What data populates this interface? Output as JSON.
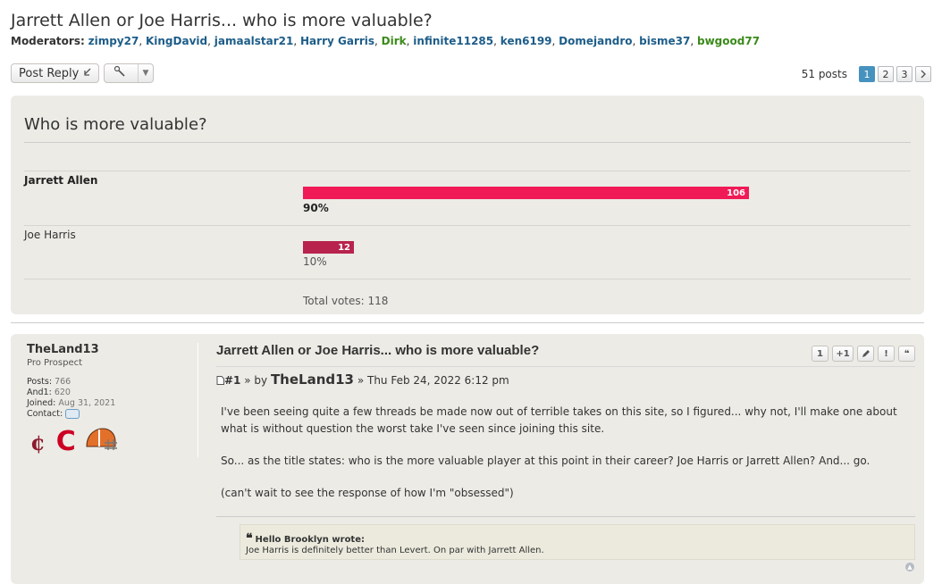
{
  "topic": {
    "title": "Jarrett Allen or Joe Harris... who is more valuable?",
    "moderators_label": "Moderators:",
    "moderators": [
      {
        "name": "zimpy27",
        "color": "#1d5d89"
      },
      {
        "name": "KingDavid",
        "color": "#1d5d89"
      },
      {
        "name": "jamaalstar21",
        "color": "#1d5d89"
      },
      {
        "name": "Harry Garris",
        "color": "#1d5d89"
      },
      {
        "name": "Dirk",
        "color": "#3b8a1b"
      },
      {
        "name": "infinite11285",
        "color": "#1d5d89"
      },
      {
        "name": "ken6199",
        "color": "#1d5d89"
      },
      {
        "name": "Domejandro",
        "color": "#1d5d89"
      },
      {
        "name": "bisme37",
        "color": "#1d5d89"
      },
      {
        "name": "bwgood77",
        "color": "#3b8a1b"
      }
    ]
  },
  "toolbar": {
    "post_reply_label": "Post Reply",
    "post_reply_icon": "reply-arrow-icon",
    "tools_icon": "wrench-icon"
  },
  "pagination": {
    "posts_count": "51 posts",
    "pages": [
      "1",
      "2",
      "3"
    ],
    "current_page": "1",
    "next_icon": "chevron-right-icon"
  },
  "poll": {
    "question": "Who is more valuable?",
    "options": [
      {
        "label": "Jarrett Allen",
        "votes": "106",
        "percent": "90%",
        "fraction": 0.898,
        "color": "#f01a56"
      },
      {
        "label": "Joe Harris",
        "votes": "12",
        "percent": "10%",
        "fraction": 0.102,
        "color": "#b8234d"
      }
    ],
    "total_votes": "Total votes: 118"
  },
  "post": {
    "author": {
      "username": "TheLand13",
      "rank": "Pro Prospect",
      "posts_label": "Posts:",
      "posts_value": "766",
      "and1_label": "And1:",
      "and1_value": "620",
      "joined_label": "Joined:",
      "joined_value": "Aug 31, 2021",
      "contact_label": "Contact:",
      "logos": [
        "cavaliers-logo",
        "guardians-logo",
        "browns-logo"
      ]
    },
    "title": "Jarrett Allen or Joe Harris... who is more valuable?",
    "action_buttons": [
      "1",
      "+1",
      "edit-icon",
      "!",
      "quote-icon"
    ],
    "meta": {
      "number": "#1",
      "by": "» by",
      "author": "TheLand13",
      "date": "» Thu Feb 24, 2022 6:12 pm"
    },
    "paragraphs": [
      "I've been seeing quite a few threads be made now out of terrible takes on this site, so I figured... why not, I'll make one about what is without question the worst take I've seen since joining this site.",
      "So... as the title states: who is the more valuable player at this point in their career? Joe Harris or Jarrett Allen? And... go.",
      "(can't wait to see the response of how I'm \"obsessed\")"
    ],
    "quote": {
      "author_line": "Hello Brooklyn wrote:",
      "text": "Joe Harris is definitely better than Levert. On par with Jarrett Allen."
    }
  }
}
